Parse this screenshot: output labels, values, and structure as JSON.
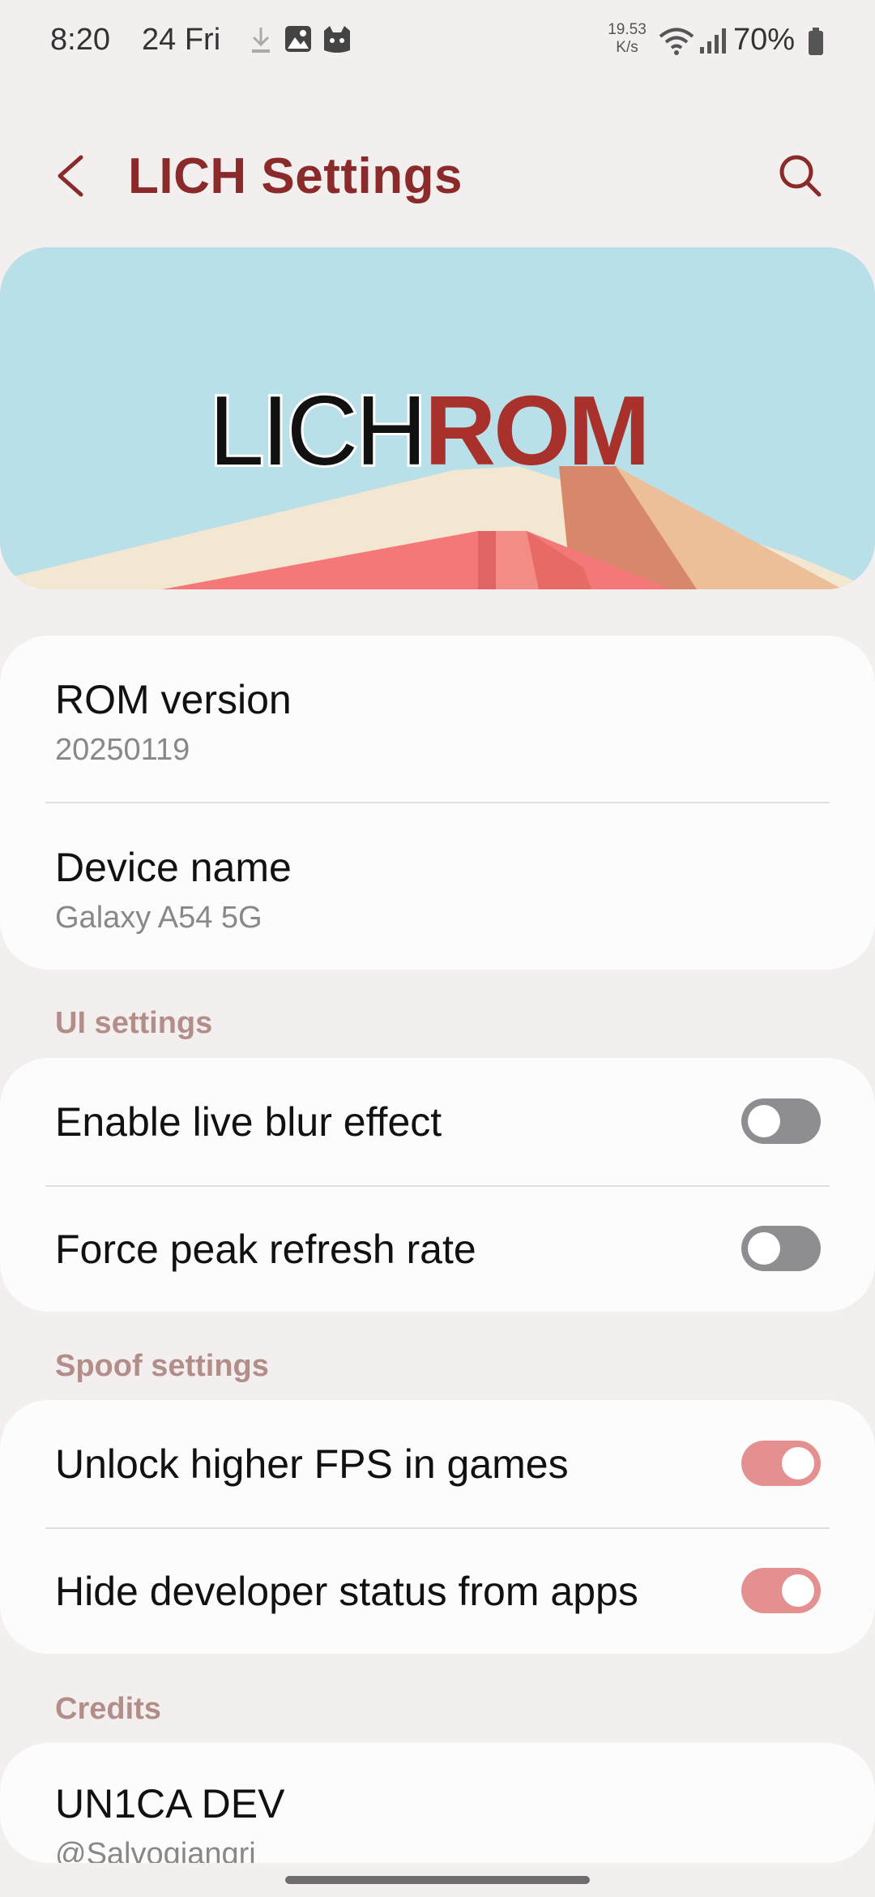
{
  "status_bar": {
    "time": "8:20",
    "date": "24 Fri",
    "net_speed_value": "19.53",
    "net_speed_unit": "K/s",
    "battery": "70%"
  },
  "header": {
    "title": "LICH Settings",
    "back_icon": "chevron-left-icon",
    "search_icon": "search-icon"
  },
  "banner": {
    "logo_part1": "LICH",
    "logo_part2": "ROM"
  },
  "info": {
    "rom_version": {
      "title": "ROM version",
      "value": "20250119"
    },
    "device_name": {
      "title": "Device name",
      "value": "Galaxy A54 5G"
    }
  },
  "ui_settings": {
    "header": "UI settings",
    "items": [
      {
        "label": "Enable live blur effect",
        "enabled": false
      },
      {
        "label": "Force peak refresh rate",
        "enabled": false
      }
    ]
  },
  "spoof_settings": {
    "header": "Spoof settings",
    "items": [
      {
        "label": "Unlock higher FPS in games",
        "enabled": true
      },
      {
        "label": "Hide developer status from apps",
        "enabled": true
      }
    ]
  },
  "credits": {
    "header": "Credits",
    "items": [
      {
        "name": "UN1CA DEV",
        "handle": "@Salvogiangri"
      }
    ]
  },
  "colors": {
    "accent": "#8b2a2a",
    "section_header": "#b38d8a",
    "switch_on": "#e59090",
    "switch_off": "#8e8d92",
    "background": "#f3efee"
  }
}
